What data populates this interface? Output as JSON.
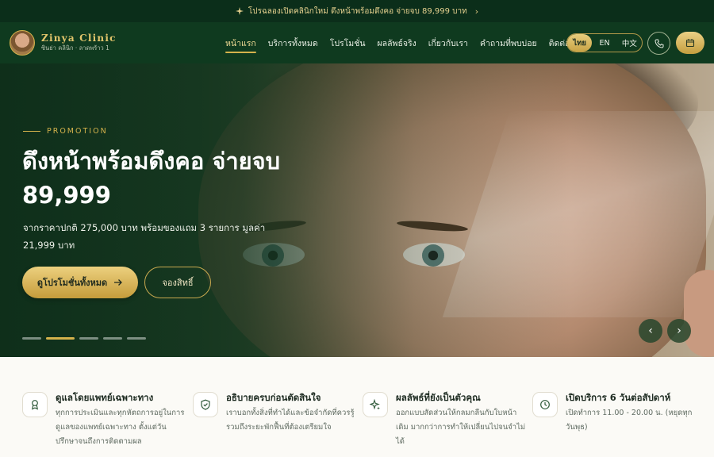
{
  "announcement": {
    "icon": "sparkle-icon",
    "text": "โปรฉลองเปิดคลินิกใหม่ ดึงหน้าพร้อมดึงคอ จ่ายจบ 89,999 บาท"
  },
  "brand": {
    "name": "Zinya Clinic",
    "subtitle": "ซินย่า คลินิก · ลาดพร้าว 1"
  },
  "nav": {
    "items": [
      {
        "label": "หน้าแรก",
        "active": true
      },
      {
        "label": "บริการทั้งหมด",
        "active": false
      },
      {
        "label": "โปรโมชั่น",
        "active": false
      },
      {
        "label": "ผลลัพธ์จริง",
        "active": false
      },
      {
        "label": "เกี่ยวกับเรา",
        "active": false
      },
      {
        "label": "คำถามที่พบบ่อย",
        "active": false
      },
      {
        "label": "ติดต่อเรา",
        "active": false
      }
    ]
  },
  "language": {
    "options": [
      "ไทย",
      "EN",
      "中文"
    ],
    "selected": "ไทย"
  },
  "hero": {
    "tag": "PROMOTION",
    "title": "ดึงหน้าพร้อมดึงคอ จ่ายจบ 89,999",
    "description": "จากราคาปกติ 275,000 บาท พร้อมของแถม 3 รายการ มูลค่า 21,999 บาท",
    "primary_button": "ดูโปรโมชั่นทั้งหมด",
    "secondary_button": "จองสิทธิ์",
    "slide_count": 5,
    "active_slide": 2
  },
  "features": [
    {
      "icon": "award-ribbon-icon",
      "title": "ดูแลโดยแพทย์เฉพาะทาง",
      "description": "ทุกการประเมินและทุกหัตถการอยู่ในการดูแลของแพทย์เฉพาะทาง ตั้งแต่วันปรึกษาจนถึงการติดตามผล"
    },
    {
      "icon": "shield-check-icon",
      "title": "อธิบายครบก่อนตัดสินใจ",
      "description": "เราบอกทั้งสิ่งที่ทำได้และข้อจำกัดที่ควรรู้ รวมถึงระยะพักฟื้นที่ต้องเตรียมใจ"
    },
    {
      "icon": "sparkle-icon",
      "title": "ผลลัพธ์ที่ยังเป็นตัวคุณ",
      "description": "ออกแบบสัดส่วนให้กลมกลืนกับใบหน้าเดิม มากกว่าการทำให้เปลี่ยนไปจนจำไม่ได้"
    },
    {
      "icon": "clock-icon",
      "title": "เปิดบริการ 6 วันต่อสัปดาห์",
      "description": "เปิดทำการ 11.00 - 20.00 น. (หยุดทุกวันพุธ)"
    }
  ],
  "colors": {
    "header_bg": "#0f3a1f",
    "announcement_bg": "#0b2e1a",
    "gold": "#d4b24c",
    "page_bg": "#fbfaf6"
  }
}
